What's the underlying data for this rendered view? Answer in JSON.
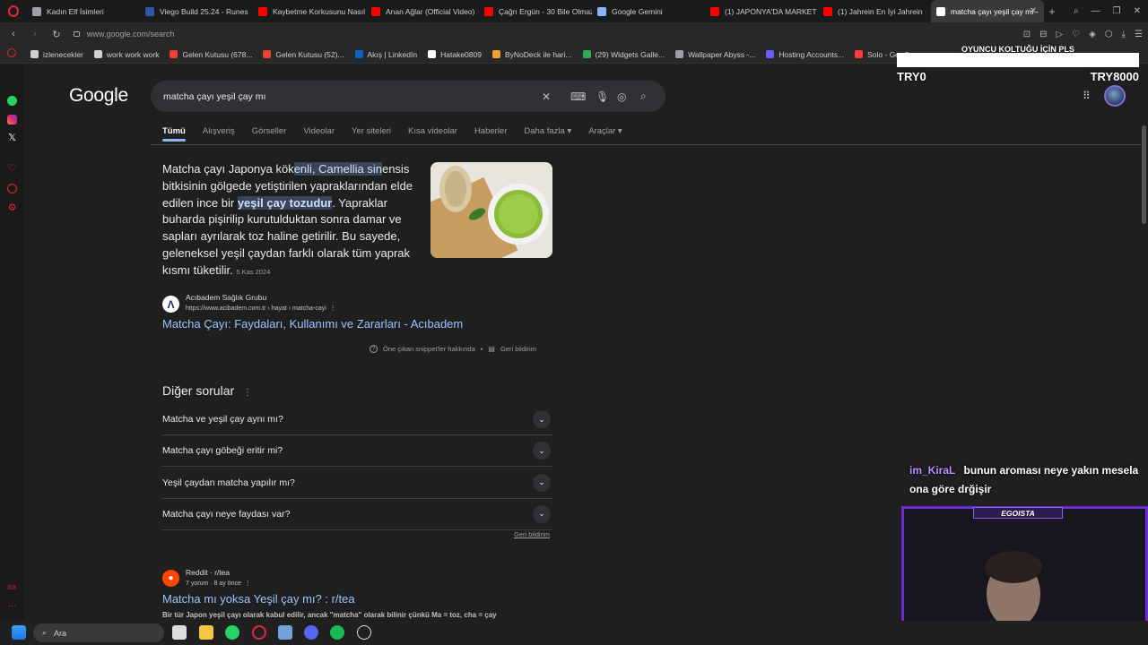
{
  "tabs": [
    {
      "label": "Kadın Elf İsimleri",
      "color": "#9aa0a6"
    },
    {
      "label": "Viego Build 25.24 - Runes",
      "color": "#2c5aa0"
    },
    {
      "label": "Kaybetme Korkusunu Nasıl",
      "color": "#ff0000"
    },
    {
      "label": "Anan Ağlar (Official Video)",
      "color": "#ff0000"
    },
    {
      "label": "Çağrı Ergün - 30 Bile Olmaz",
      "color": "#ff0000"
    },
    {
      "label": "Google Gemini",
      "color": "#8ab4f8"
    },
    {
      "label": "(1) JAPONYA'DA MARKET",
      "color": "#ff0000"
    },
    {
      "label": "(1) Jahrein En İyi Jahrein",
      "color": "#ff0000"
    },
    {
      "label": "matcha çayı yeşil çay mı - ",
      "color": "#ffffff"
    }
  ],
  "address": {
    "url": "www.google.com/search"
  },
  "bookmarks": [
    {
      "label": "izlenecekler",
      "color": "#cfcfcf"
    },
    {
      "label": "work work work",
      "color": "#cfcfcf"
    },
    {
      "label": "Gelen Kutusu (678...",
      "color": "#ea4335"
    },
    {
      "label": "Gelen Kutusu (52)...",
      "color": "#ea4335"
    },
    {
      "label": "Akış | LinkedIn",
      "color": "#0a66c2"
    },
    {
      "label": "Hatake0809",
      "color": "#ffffff"
    },
    {
      "label": "ByNoDeck ile hari...",
      "color": "#f0a030"
    },
    {
      "label": "(29) Widgets Galle...",
      "color": "#34a853"
    },
    {
      "label": "Wallpaper Abyss -...",
      "color": "#9aa0a6"
    },
    {
      "label": "Hosting Accounts...",
      "color": "#6a5cff"
    },
    {
      "label": "Solo - GeoGuessr",
      "color": "#ff3b3b"
    }
  ],
  "google": {
    "logo": "Google",
    "query": "matcha çayı yeşil çay mı",
    "nav": [
      "Tümü",
      "Alışveriş",
      "Görseller",
      "Videolar",
      "Yer siteleri",
      "Kısa videolar",
      "Haberler",
      "Daha fazla ▾",
      "Araçlar ▾"
    ],
    "snippet": {
      "p1": "Matcha çayı Japonya kök",
      "h1": "enli, Camellia sin",
      "p2": "ensis bitkisinin gölgede yetiştirilen yapraklarından elde edilen ince bir ",
      "h2": "yeşil çay tozudur",
      "p3": ". Yapraklar buharda pişirilip kurutulduktan sonra damar ve sapları ayrılarak toz haline getirilir. Bu sayede, geleneksel yeşil çaydan farklı olarak tüm yaprak kısmı tüketilir.",
      "date": "5 Kas 2024"
    },
    "source": {
      "name": "Acıbadem Sağlık Grubu",
      "url": "https://www.acibadem.com.tr › hayat › matcha-cayi",
      "title": "Matcha Çayı: Faydaları, Kullanımı ve Zararları - Acıbadem"
    },
    "snippet_footer": {
      "about": "Öne çıkan snippet'ler hakkında",
      "feedback": "Geri bildirim"
    },
    "paa": {
      "title": "Diğer sorular",
      "questions": [
        "Matcha ve yeşil çay aynı mı?",
        "Matcha çayı göbeği eritir mi?",
        "Yeşil çaydan matcha yapılır mı?",
        "Matcha çayı neye faydası var?"
      ],
      "feedback": "Geri bildirim"
    },
    "reddit": {
      "source": "Reddit · r/tea",
      "meta": "7 yorum · 8 ay önce",
      "title": "Matcha mı yoksa Yeşil çay mı? : r/tea",
      "snippet": "Bir tür Japon yeşil çayı olarak kabul edilir, ancak \"matcha\" olarak bilinir çünkü Ma = toz, cha = çay"
    }
  },
  "overlay": {
    "title": "OYUNCU KOLTUĞU İÇİN PLS",
    "left": "TRY0",
    "right": "TRY8000"
  },
  "chat": {
    "user": "im_KiraL",
    "message": "bunun aroması neye yakın mesela ona göre drğişir"
  },
  "cam": {
    "label": "EGOISTA"
  },
  "taskbar": {
    "search": "Ara"
  }
}
